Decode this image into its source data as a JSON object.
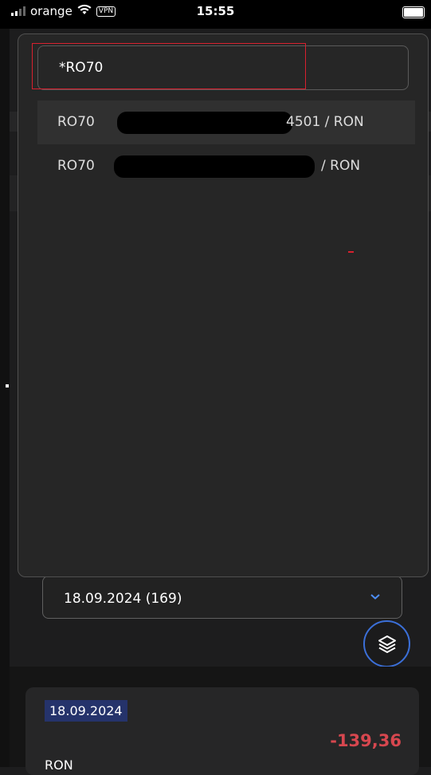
{
  "status_bar": {
    "carrier": "orange",
    "vpn": "VPN",
    "time": "15:55"
  },
  "search": {
    "value": "*RO70"
  },
  "options": [
    {
      "prefix": "RO70",
      "suffix": "4501 / RON",
      "selected": true
    },
    {
      "prefix": "RO70",
      "suffix": "/ RON",
      "selected": false
    }
  ],
  "date_select": {
    "value": "18.09.2024 (169)"
  },
  "transaction": {
    "date": "18.09.2024",
    "amount": "-139,36",
    "currency": "RON"
  },
  "icons": {
    "layers": "layers-icon",
    "chevron": "chevron-down-icon"
  },
  "colors": {
    "accent": "#3b6fd8",
    "negative": "#d7474f",
    "highlight": "#d8202f"
  }
}
